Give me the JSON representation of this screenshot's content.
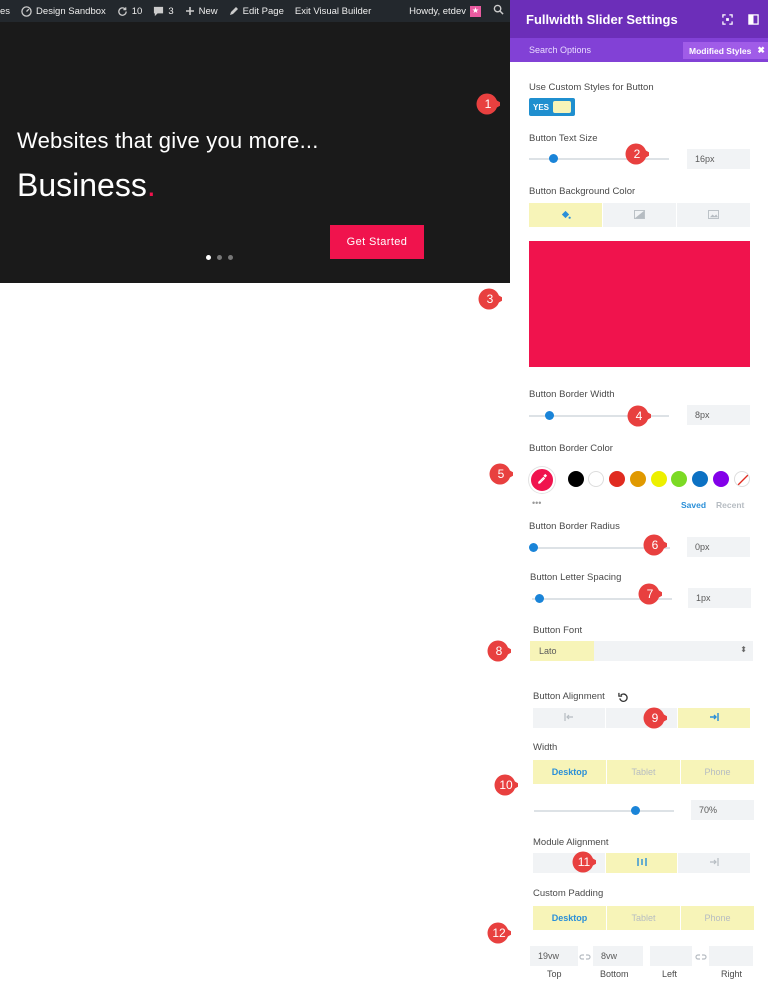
{
  "adminbar": {
    "site_fragment": "es",
    "site_name": "Design Sandbox",
    "updates_count": "10",
    "comments_count": "3",
    "new_label": "New",
    "edit_page_label": "Edit Page",
    "exit_builder_label": "Exit Visual Builder",
    "howdy_label": "Howdy, etdev"
  },
  "hero": {
    "subheading": "Websites that give you more...",
    "heading": "Business",
    "heading_dot": ".",
    "button_label": "Get Started",
    "slide_count": 3,
    "active_slide": 1
  },
  "panel": {
    "title": "Fullwidth Slider Settings",
    "search_label": "Search Options",
    "modified_styles_label": "Modified Styles",
    "modified_styles_close": "✖",
    "use_custom_styles": {
      "label": "Use Custom Styles for Button",
      "value": "YES"
    },
    "text_size": {
      "label": "Button Text Size",
      "value": "16px",
      "level": 0.15
    },
    "bg_color": {
      "label": "Button Background Color",
      "value": "#f0134d"
    },
    "border_width": {
      "label": "Button Border Width",
      "value": "8px",
      "level": 0.12
    },
    "border_color": {
      "label": "Button Border Color",
      "selected": "#f0134d",
      "swatches": [
        "#000000",
        "#ffffff",
        "#e02b20",
        "#e09900",
        "#edf000",
        "#7cda24",
        "#0c71c3",
        "#8300e9"
      ],
      "saved_label": "Saved",
      "recent_label": "Recent",
      "more_label": "•••"
    },
    "border_radius": {
      "label": "Button Border Radius",
      "value": "0px",
      "level": 0.0
    },
    "letter_spacing": {
      "label": "Button Letter Spacing",
      "value": "1px",
      "level": 0.03
    },
    "font": {
      "label": "Button Font",
      "value": "Lato"
    },
    "alignment": {
      "label": "Button Alignment",
      "selected": "right"
    },
    "width": {
      "label": "Width",
      "tabs": [
        "Desktop",
        "Tablet",
        "Phone"
      ],
      "active_tab": "Desktop",
      "value": "70%",
      "level": 0.7
    },
    "module_alignment": {
      "label": "Module Alignment",
      "selected": "center"
    },
    "padding": {
      "label": "Custom Padding",
      "tabs": [
        "Desktop",
        "Tablet",
        "Phone"
      ],
      "active_tab": "Desktop",
      "top": "19vw",
      "bottom": "8vw",
      "left": "",
      "right": "",
      "top_label": "Top",
      "bottom_label": "Bottom",
      "left_label": "Left",
      "right_label": "Right"
    }
  },
  "callouts": [
    "1",
    "2",
    "3",
    "4",
    "5",
    "6",
    "7",
    "8",
    "9",
    "10",
    "11",
    "12"
  ],
  "colors": {
    "accent": "#f0134d",
    "panel_header": "#6c2eb9",
    "panel_subbar": "#8241d6",
    "toggle": "#1f8fcf",
    "highlight": "#f7f4b8",
    "callout": "#e8403f"
  }
}
